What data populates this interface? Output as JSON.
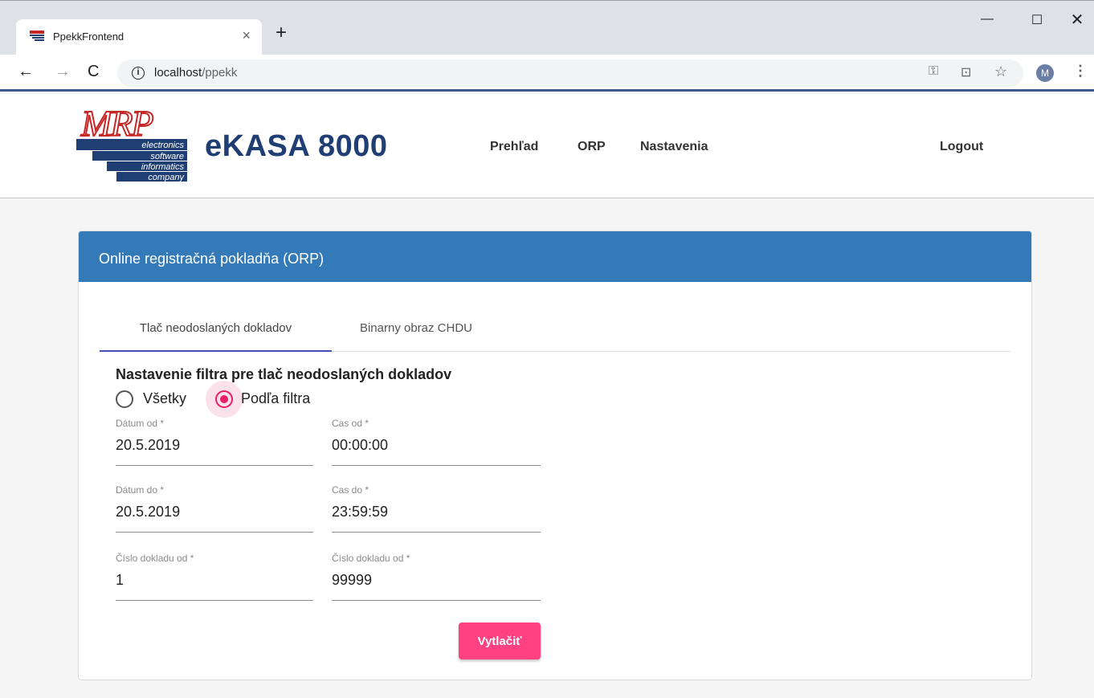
{
  "browser": {
    "tab_title": "PpekkFrontend",
    "tab_close": "×",
    "new_tab": "+",
    "url_host": "localhost",
    "url_path": "/ppekk",
    "avatar_initial": "M",
    "window": {
      "minimize": "—",
      "maximize": "☐",
      "close": "✕"
    }
  },
  "header": {
    "logo": {
      "wordmark": "MRP",
      "lines": [
        "electronics",
        "software",
        "informatics",
        "company"
      ]
    },
    "brand": "eKASA 8000",
    "nav": [
      "Prehľad",
      "ORP",
      "Nastavenia"
    ],
    "logout": "Logout"
  },
  "card": {
    "title": "Online registračná pokladňa (ORP)",
    "tabs": [
      "Tlač neodoslaných dokladov",
      "Binarny obraz CHDU"
    ],
    "active_tab": 0,
    "filter_title": "Nastavenie filtra pre tlač neodoslaných dokladov",
    "radio": {
      "all_label": "Všetky",
      "filter_label": "Podľa filtra",
      "selected": "filter"
    },
    "fields": {
      "datum_od": {
        "label": "Dátum od *",
        "value": "20.5.2019"
      },
      "cas_od": {
        "label": "Cas od *",
        "value": "00:00:00"
      },
      "datum_do": {
        "label": "Dátum do *",
        "value": "20.5.2019"
      },
      "cas_do": {
        "label": "Cas do *",
        "value": "23:59:59"
      },
      "cislo_od": {
        "label": "Číslo dokladu od *",
        "value": "1"
      },
      "cislo_do": {
        "label": "Číslo dokladu od *",
        "value": "99999"
      }
    },
    "print_button": "Vytlačiť"
  },
  "colors": {
    "card_header": "#357ab8",
    "accent_pink": "#ff4081",
    "brand_navy": "#1f3f74",
    "tab_indicator": "#3f51b5"
  }
}
